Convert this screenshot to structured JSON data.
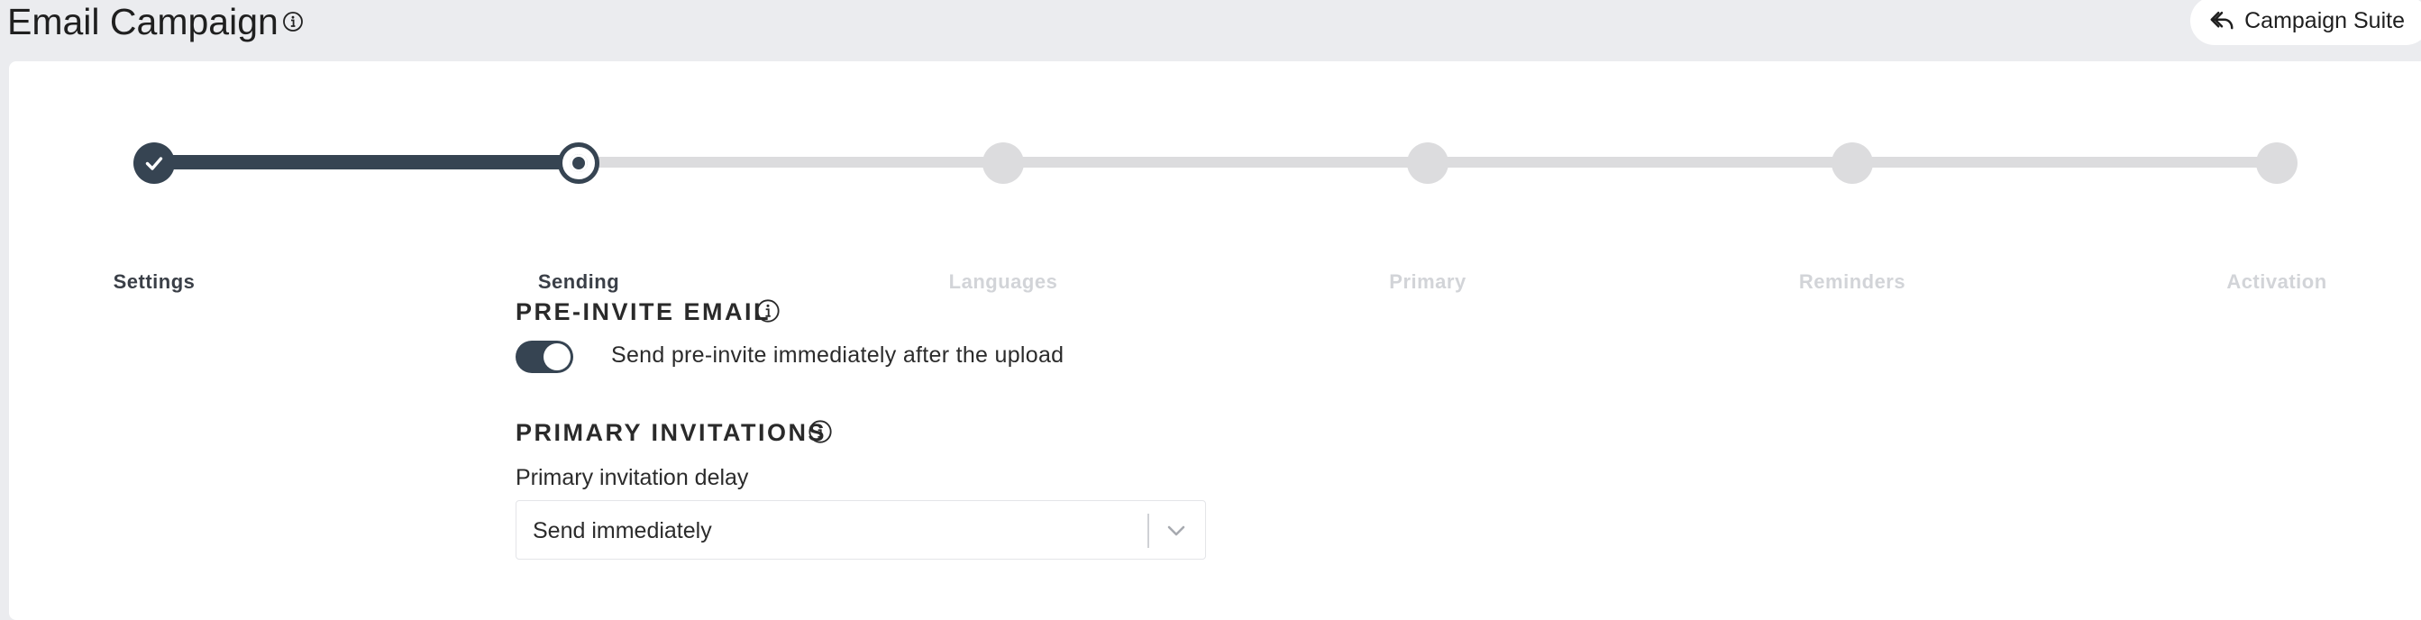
{
  "header": {
    "title": "Email Campaign",
    "suite_button_label": "Campaign Suite"
  },
  "stepper": {
    "steps": [
      {
        "label": "Settings",
        "state": "done"
      },
      {
        "label": "Sending",
        "state": "current"
      },
      {
        "label": "Languages",
        "state": "upcoming"
      },
      {
        "label": "Primary",
        "state": "upcoming"
      },
      {
        "label": "Reminders",
        "state": "upcoming"
      },
      {
        "label": "Activation",
        "state": "upcoming"
      }
    ]
  },
  "pre_invite": {
    "title": "PRE-INVITE EMAIL",
    "toggle_label": "Send pre-invite immediately after the upload",
    "toggle_on": true
  },
  "primary_invitations": {
    "title": "PRIMARY INVITATIONS",
    "delay_label": "Primary invitation delay",
    "delay_value": "Send immediately"
  },
  "colors": {
    "accent": "#364452",
    "inactive": "#dcdcde",
    "page_bg": "#ebecef"
  }
}
